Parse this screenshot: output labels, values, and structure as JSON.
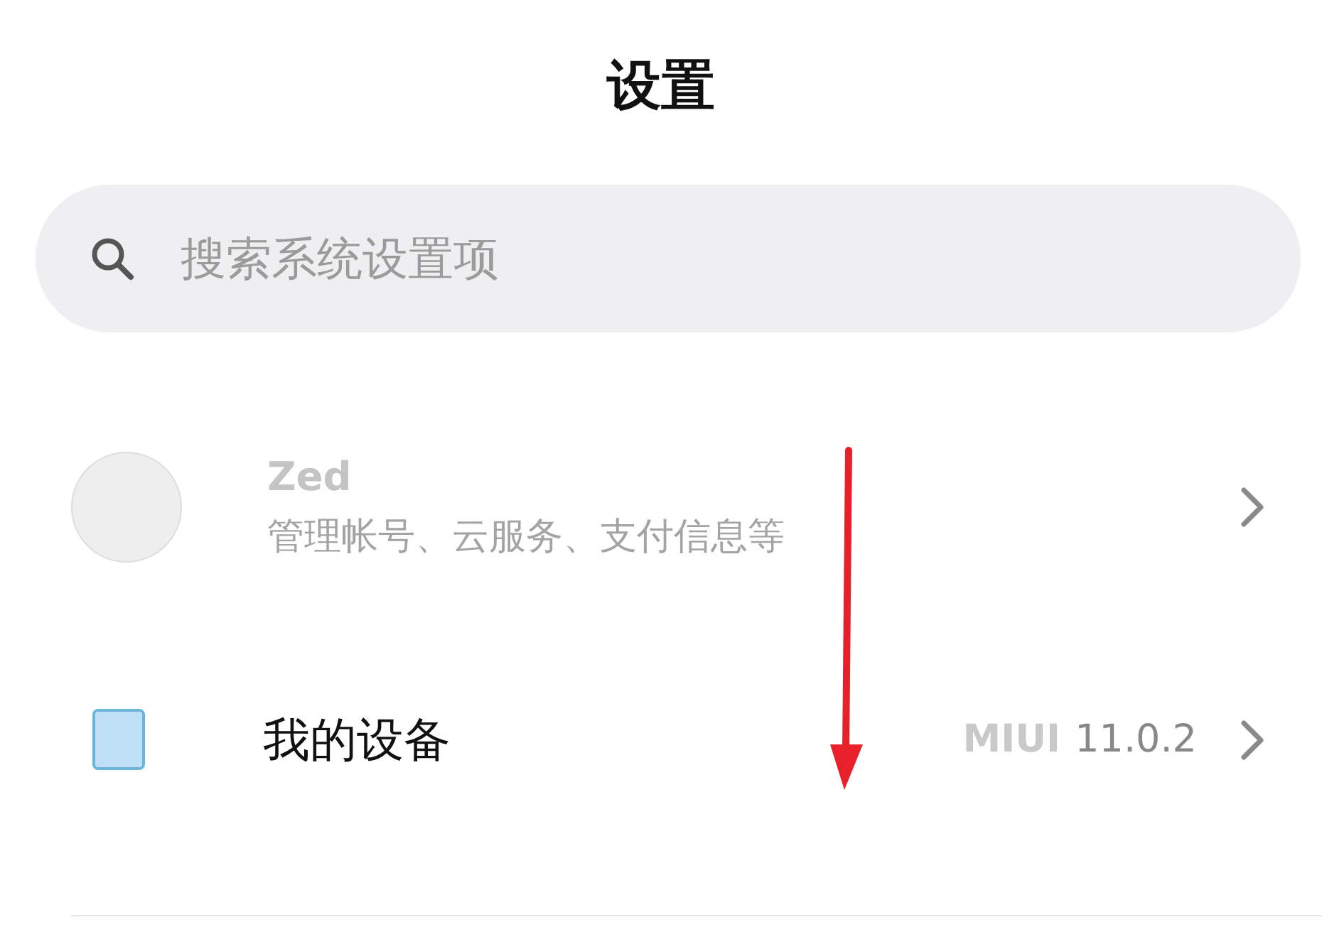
{
  "header": {
    "title": "设置"
  },
  "search": {
    "placeholder": "搜索系统设置项"
  },
  "account": {
    "name": "Zed",
    "subtitle": "管理帐号、云服务、支付信息等"
  },
  "items": [
    {
      "label": "我的设备",
      "prefix": "MIUI",
      "value": "11.0.2"
    }
  ],
  "annotation": {
    "kind": "arrow-down",
    "color": "#e8202a"
  }
}
